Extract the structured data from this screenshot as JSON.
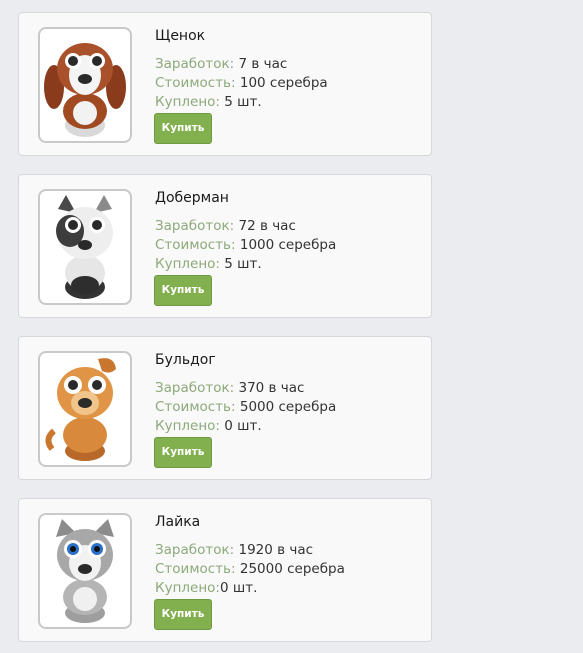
{
  "items": [
    {
      "name": "Щенок",
      "earn_label": "Заработок:",
      "earn_value": " 7 в час",
      "cost_label": "Стоимость:",
      "cost_value": " 100 серебра",
      "bought_label": "Куплено:",
      "bought_value": " 5 шт.",
      "buy_label": "Купить",
      "icon": "puppy-icon"
    },
    {
      "name": "Доберман",
      "earn_label": "Заработок:",
      "earn_value": " 72 в час",
      "cost_label": "Стоимость:",
      "cost_value": " 1000 серебра",
      "bought_label": "Куплено:",
      "bought_value": " 5 шт.",
      "buy_label": "Купить",
      "icon": "doberman-icon"
    },
    {
      "name": "Бульдог",
      "earn_label": "Заработок:",
      "earn_value": " 370 в час",
      "cost_label": "Стоимость:",
      "cost_value": " 5000 серебра",
      "bought_label": "Куплено:",
      "bought_value": " 0 шт.",
      "buy_label": "Купить",
      "icon": "bulldog-icon"
    },
    {
      "name": "Лайка",
      "earn_label": "Заработок:",
      "earn_value": " 1920 в час",
      "cost_label": "Стоимость:",
      "cost_value": " 25000 серебра",
      "bought_label": "Куплено:",
      "bought_value": "0 шт.",
      "buy_label": "Купить",
      "icon": "husky-icon"
    }
  ],
  "colors": {
    "background": "#ebecf0",
    "card": "#f9f9f9",
    "label": "#8da97a",
    "button": "#82b04f"
  }
}
